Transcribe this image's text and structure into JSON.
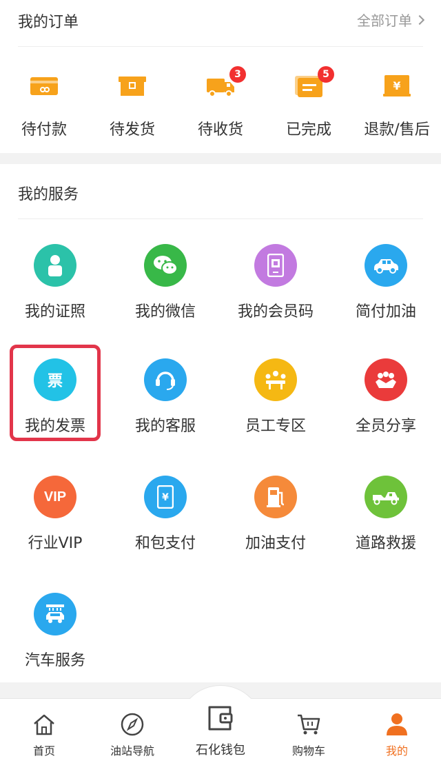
{
  "orders": {
    "title": "我的订单",
    "all_link": "全部订单",
    "accent": "#f7a21b",
    "items": [
      {
        "label": "待付款",
        "icon": "wallet-card-icon"
      },
      {
        "label": "待发货",
        "icon": "box-icon"
      },
      {
        "label": "待收货",
        "icon": "truck-icon",
        "badge": "3"
      },
      {
        "label": "已完成",
        "icon": "completed-list-icon",
        "badge": "5"
      },
      {
        "label": "退款/售后",
        "icon": "refund-yuan-icon"
      }
    ]
  },
  "services": {
    "title": "我的服务",
    "items": [
      {
        "label": "我的证照",
        "icon": "id-person-icon",
        "color": "#2bc2a9"
      },
      {
        "label": "我的微信",
        "icon": "wechat-icon",
        "color": "#38b848"
      },
      {
        "label": "我的会员码",
        "icon": "member-code-icon",
        "color": "#c27ae0"
      },
      {
        "label": "简付加油",
        "icon": "car-icon",
        "color": "#2aa8ee"
      },
      {
        "label": "我的发票",
        "icon": "invoice-icon",
        "glyph": "票",
        "color": "#22c2e6"
      },
      {
        "label": "我的客服",
        "icon": "headset-icon",
        "color": "#2aa8ee"
      },
      {
        "label": "员工专区",
        "icon": "staff-meeting-icon",
        "color": "#f5b813"
      },
      {
        "label": "全员分享",
        "icon": "share-people-icon",
        "color": "#ea3b3b"
      },
      {
        "label": "行业VIP",
        "icon": "vip-icon",
        "glyph": "VIP",
        "color": "#f5683a"
      },
      {
        "label": "和包支付",
        "icon": "phone-pay-icon",
        "color": "#2aa8ee"
      },
      {
        "label": "加油支付",
        "icon": "fuel-pump-icon",
        "color": "#f58a3a"
      },
      {
        "label": "道路救援",
        "icon": "tow-truck-icon",
        "color": "#6ec23a"
      },
      {
        "label": "汽车服务",
        "icon": "car-wash-icon",
        "color": "#2aa8ee"
      }
    ]
  },
  "tabbar": {
    "items": [
      {
        "label": "首页",
        "icon": "home-icon"
      },
      {
        "label": "油站导航",
        "icon": "compass-icon"
      },
      {
        "label": "石化钱包",
        "icon": "wallet-icon"
      },
      {
        "label": "购物车",
        "icon": "cart-icon"
      },
      {
        "label": "我的",
        "icon": "profile-icon",
        "active": true
      }
    ],
    "active_color": "#f07020"
  }
}
